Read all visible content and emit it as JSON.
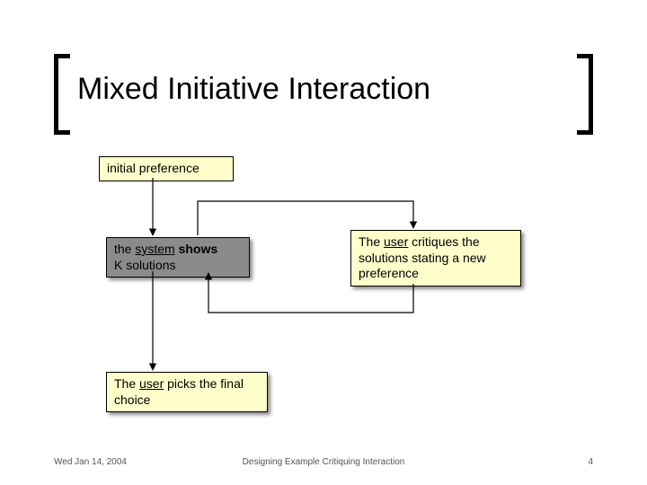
{
  "title": "Mixed Initiative Interaction",
  "boxes": {
    "initial": "initial preference",
    "system_line1_a": "the ",
    "system_line1_b": "system",
    "system_line1_c": " shows",
    "system_line2": "K solutions",
    "critique_line1_a": "The ",
    "critique_line1_b": "user",
    "critique_line1_c": " critiques the",
    "critique_line2": "solutions stating a new",
    "critique_line3": "preference",
    "final_line1_a": "The ",
    "final_line1_b": "user",
    "final_line1_c": " picks the final",
    "final_line2": "choice"
  },
  "footer": {
    "date": "Wed Jan 14, 2004",
    "center": "Designing Example Critiquing Interaction",
    "page": "4"
  },
  "colors": {
    "note_bg": "#ffffcc",
    "dark_bg": "#8b8b8b"
  }
}
